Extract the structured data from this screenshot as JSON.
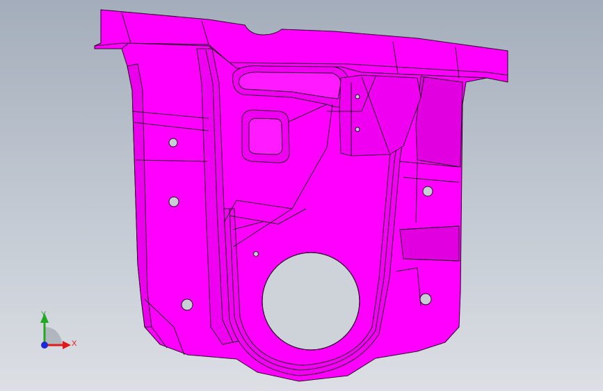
{
  "viewport": {
    "part_color": "#ff00ff",
    "part_shade": "#e000e0",
    "edge_color": "#2a002a"
  },
  "triad": {
    "y_label": "Y",
    "x_label": "X",
    "y_color": "#22a822",
    "x_color": "#e01818",
    "z_color": "#1a28d8"
  }
}
